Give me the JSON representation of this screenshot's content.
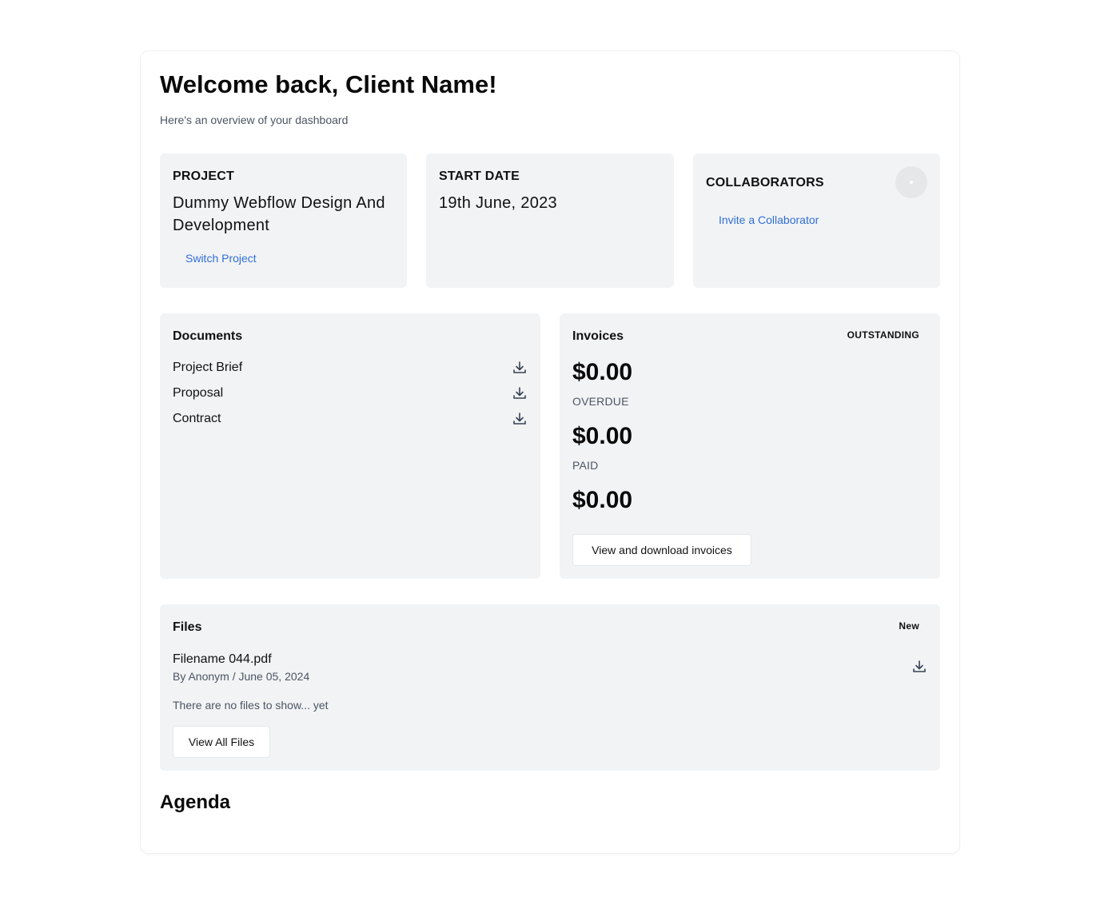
{
  "header": {
    "title": "Welcome back, Client Name!",
    "subtitle": "Here's an overview of your dashboard"
  },
  "project_card": {
    "label": "PROJECT",
    "value": "Dummy Webflow Design And Development",
    "link": "Switch Project"
  },
  "start_date_card": {
    "label": "START DATE",
    "value": "19th June, 2023"
  },
  "collaborators_card": {
    "label": "COLLABORATORS",
    "link": "Invite a Collaborator"
  },
  "documents": {
    "title": "Documents",
    "items": [
      {
        "name": "Project Brief",
        "icon": "download-icon"
      },
      {
        "name": "Proposal",
        "icon": "download-icon"
      },
      {
        "name": "Contract",
        "icon": "download-icon"
      }
    ]
  },
  "invoices": {
    "title": "Invoices",
    "badge": "OUTSTANDING",
    "outstanding_amount": "$0.00",
    "overdue_label": "OVERDUE",
    "overdue_amount": "$0.00",
    "paid_label": "PAID",
    "paid_amount": "$0.00",
    "button": "View and download invoices"
  },
  "files": {
    "title": "Files",
    "badge": "New",
    "file_name": "Filename 044.pdf",
    "file_meta": "By Anonym / June 05, 2024",
    "empty_message": "There are no files to show... yet",
    "button": "View All Files"
  },
  "agenda": {
    "title": "Agenda"
  },
  "colors": {
    "link": "#2f6fd6",
    "card_bg": "#f2f3f5",
    "muted_text": "#4b5563"
  }
}
